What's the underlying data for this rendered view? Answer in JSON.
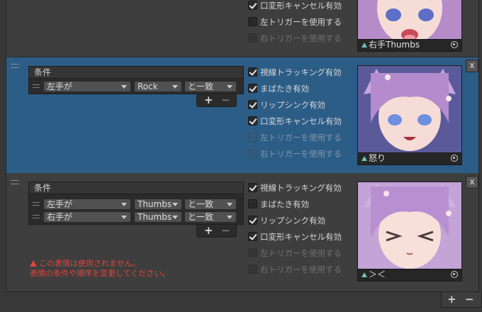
{
  "entries": [
    {
      "options": [
        {
          "label": "口変形キャンセル有効",
          "checked": true,
          "enabled": true
        },
        {
          "label": "左トリガーを使用する",
          "checked": false,
          "enabled": true
        },
        {
          "label": "右トリガーを使用する",
          "checked": false,
          "enabled": false
        }
      ],
      "preview_name": "右手Thumbs"
    },
    {
      "conditions_header": "条件",
      "conditions": [
        {
          "hand": "左手が",
          "gesture": "Rock",
          "operator": "と一致"
        }
      ],
      "options": [
        {
          "label": "視線トラッキング有効",
          "checked": true,
          "enabled": true
        },
        {
          "label": "まばたき有効",
          "checked": true,
          "enabled": true
        },
        {
          "label": "リップシンク有効",
          "checked": true,
          "enabled": true
        },
        {
          "label": "口変形キャンセル有効",
          "checked": true,
          "enabled": true
        },
        {
          "label": "左トリガーを使用する",
          "checked": false,
          "enabled": false
        },
        {
          "label": "右トリガーを使用する",
          "checked": false,
          "enabled": false
        }
      ],
      "preview_name": "怒り",
      "remove_label": "x"
    },
    {
      "conditions_header": "条件",
      "conditions": [
        {
          "hand": "左手が",
          "gesture": "Thumbs",
          "operator": "と一致"
        },
        {
          "hand": "右手が",
          "gesture": "Thumbs",
          "operator": "と一致"
        }
      ],
      "options": [
        {
          "label": "視線トラッキング有効",
          "checked": true,
          "enabled": true
        },
        {
          "label": "まばたき有効",
          "checked": false,
          "enabled": true
        },
        {
          "label": "リップシンク有効",
          "checked": true,
          "enabled": true
        },
        {
          "label": "口変形キャンセル有効",
          "checked": true,
          "enabled": true
        },
        {
          "label": "左トリガーを使用する",
          "checked": false,
          "enabled": false
        },
        {
          "label": "右トリガーを使用する",
          "checked": false,
          "enabled": false
        }
      ],
      "preview_name": "＞＜",
      "remove_label": "x",
      "warning_lines": [
        "この表情は使用されません。",
        "表情の条件や順序を変更してください。"
      ]
    }
  ],
  "buttons": {
    "add": "+",
    "remove": "−"
  },
  "colors": {
    "selected_bg": "#2c5d87",
    "panel_bg": "#3e3e3e",
    "warning": "#e0443a"
  }
}
